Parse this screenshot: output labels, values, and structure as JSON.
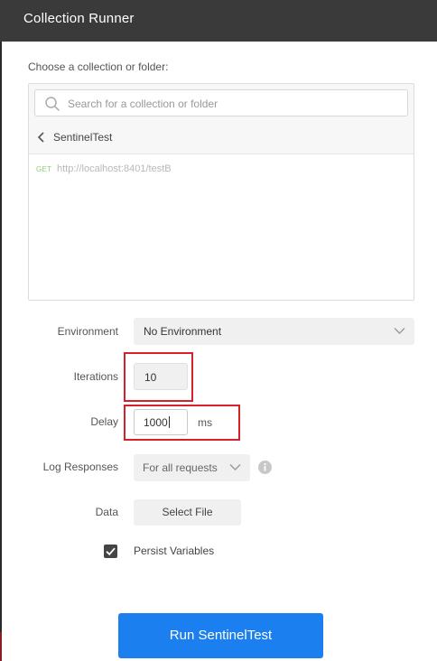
{
  "window": {
    "title": "Collection Runner"
  },
  "picker": {
    "label": "Choose a collection or folder:",
    "search_placeholder": "Search for a collection or folder",
    "folder_name": "SentinelTest",
    "requests": [
      {
        "method": "GET",
        "url": "http://localhost:8401/testB"
      }
    ]
  },
  "form": {
    "environment": {
      "label": "Environment",
      "value": "No Environment"
    },
    "iterations": {
      "label": "Iterations",
      "value": "10"
    },
    "delay": {
      "label": "Delay",
      "value": "1000",
      "unit": "ms"
    },
    "log_responses": {
      "label": "Log Responses",
      "value": "For all requests"
    },
    "data": {
      "label": "Data",
      "button_label": "Select File"
    },
    "persist_variables": {
      "label": "Persist Variables",
      "checked": true
    }
  },
  "run_button": {
    "label": "Run SentinelTest"
  },
  "colors": {
    "accent": "#1b7ff0",
    "highlight": "#d4212b",
    "titlebar": "#3a3a3a",
    "method_get": "#8ccf7e"
  },
  "icons": {
    "search": "search-icon",
    "back": "chevron-left-icon",
    "dropdown": "chevron-down-icon",
    "info": "info-icon",
    "checkbox": "checkmark-icon"
  }
}
